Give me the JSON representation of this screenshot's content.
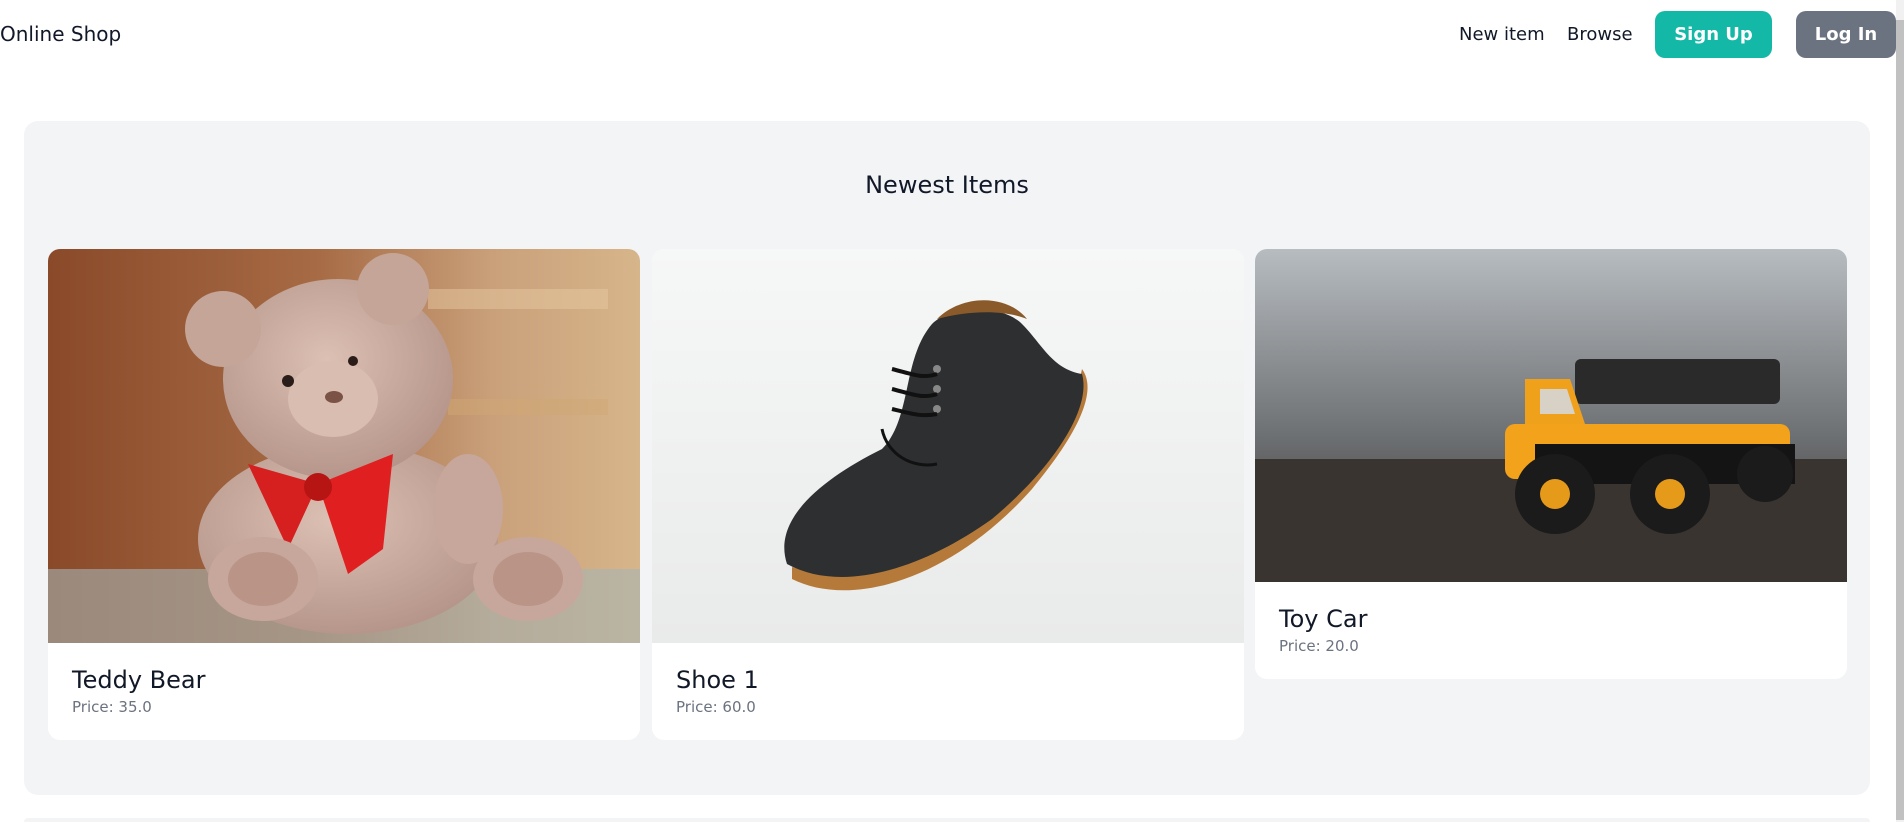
{
  "nav": {
    "brand": "Online Shop",
    "links": [
      "New item",
      "Browse"
    ],
    "signup": "Sign Up",
    "login": "Log In"
  },
  "section": {
    "title": "Newest Items"
  },
  "items": [
    {
      "name": "Teddy Bear",
      "price": "Price: 35.0"
    },
    {
      "name": "Shoe 1",
      "price": "Price: 60.0"
    },
    {
      "name": "Toy Car",
      "price": "Price: 20.0"
    }
  ],
  "colors": {
    "signup": "#14b8a6",
    "login": "#6b7280",
    "panel": "#f3f4f6"
  }
}
